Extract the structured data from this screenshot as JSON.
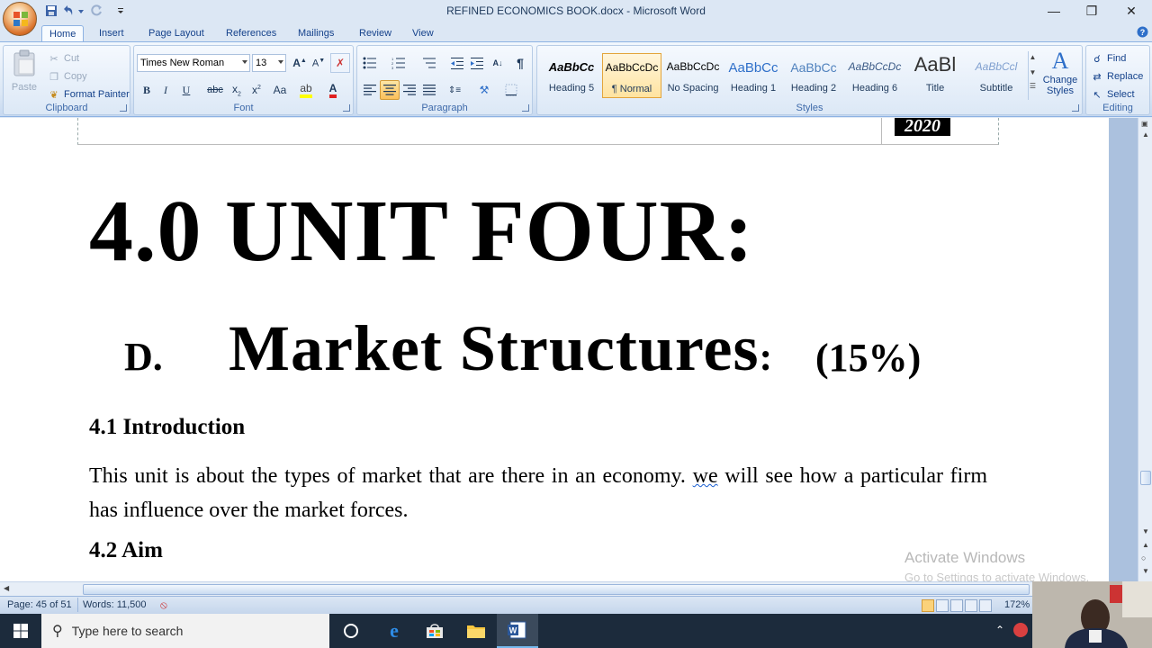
{
  "window": {
    "title": "REFINED ECONOMICS BOOK.docx - Microsoft Word"
  },
  "ribbon": {
    "tabs": [
      "Home",
      "Insert",
      "Page Layout",
      "References",
      "Mailings",
      "Review",
      "View"
    ],
    "active_tab": "Home",
    "clipboard": {
      "label": "Clipboard",
      "paste": "Paste",
      "cut": "Cut",
      "copy": "Copy",
      "format_painter": "Format Painter"
    },
    "font": {
      "label": "Font",
      "font_name": "Times New Roman",
      "font_size": "13",
      "change_case": "Aa"
    },
    "paragraph": {
      "label": "Paragraph"
    },
    "styles": {
      "label": "Styles",
      "items": [
        {
          "preview": "AaBbCc",
          "name": "Heading 5"
        },
        {
          "preview": "AaBbCcDc",
          "name": "¶ Normal"
        },
        {
          "preview": "AaBbCcDc",
          "name": "No Spacing"
        },
        {
          "preview": "AaBbCc",
          "name": "Heading 1"
        },
        {
          "preview": "AaBbCc",
          "name": "Heading 2"
        },
        {
          "preview": "AaBbCcDc",
          "name": "Heading 6"
        },
        {
          "preview": "AaBl",
          "name": "Title"
        },
        {
          "preview": "AaBbCcl",
          "name": "Subtitle"
        }
      ],
      "change_styles": "Change Styles"
    },
    "editing": {
      "label": "Editing",
      "find": "Find",
      "replace": "Replace",
      "select": "Select"
    }
  },
  "document": {
    "header_year": "2020",
    "unit_title": "4.0 UNIT FOUR:",
    "section_letter": "D.",
    "section_title": "Market Structures",
    "section_colon": ":",
    "section_percent": "(15%)",
    "intro_heading": "4.1 Introduction",
    "intro_text_before": "This unit is about the types of market that are there in an economy. ",
    "intro_flagged_word": "we",
    "intro_text_after": " will see how a particular firm has influence over the market forces.",
    "aim_heading": "4.2 Aim",
    "watermark_line1": "Activate Windows",
    "watermark_line2": "Go to Settings to activate Windows."
  },
  "statusbar": {
    "page": "Page: 45 of 51",
    "words": "Words: 11,500",
    "zoom": "172%"
  },
  "taskbar": {
    "search_placeholder": "Type here to search"
  },
  "colors": {
    "ribbon_text": "#15428b",
    "taskbar": "#1c2b3c",
    "selected_style": "#ffe3a0"
  }
}
